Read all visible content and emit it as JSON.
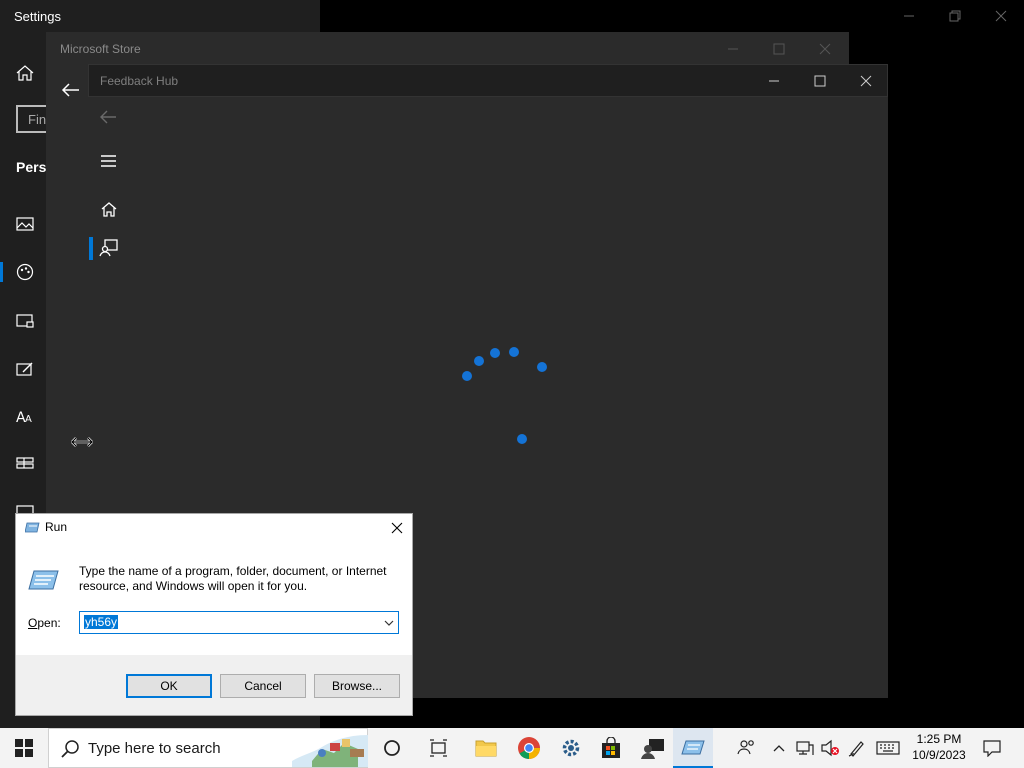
{
  "settings": {
    "title": "Settings",
    "search_partial": "Fin",
    "section_partial": "Pers"
  },
  "store": {
    "title": "Microsoft Store"
  },
  "feedback_hub": {
    "title": "Feedback Hub"
  },
  "run": {
    "title": "Run",
    "description": "Type the name of a program, folder, document, or Internet resource, and Windows will open it for you.",
    "open_label_accel": "O",
    "open_label_rest": "pen:",
    "input_value": "yh56y",
    "ok_label": "OK",
    "cancel_label": "Cancel",
    "browse_label": "Browse..."
  },
  "taskbar": {
    "search_placeholder": "Type here to search",
    "time": "1:25 PM",
    "date": "10/9/2023"
  },
  "colors": {
    "accent": "#0078d7",
    "spinner": "#1473d6"
  }
}
